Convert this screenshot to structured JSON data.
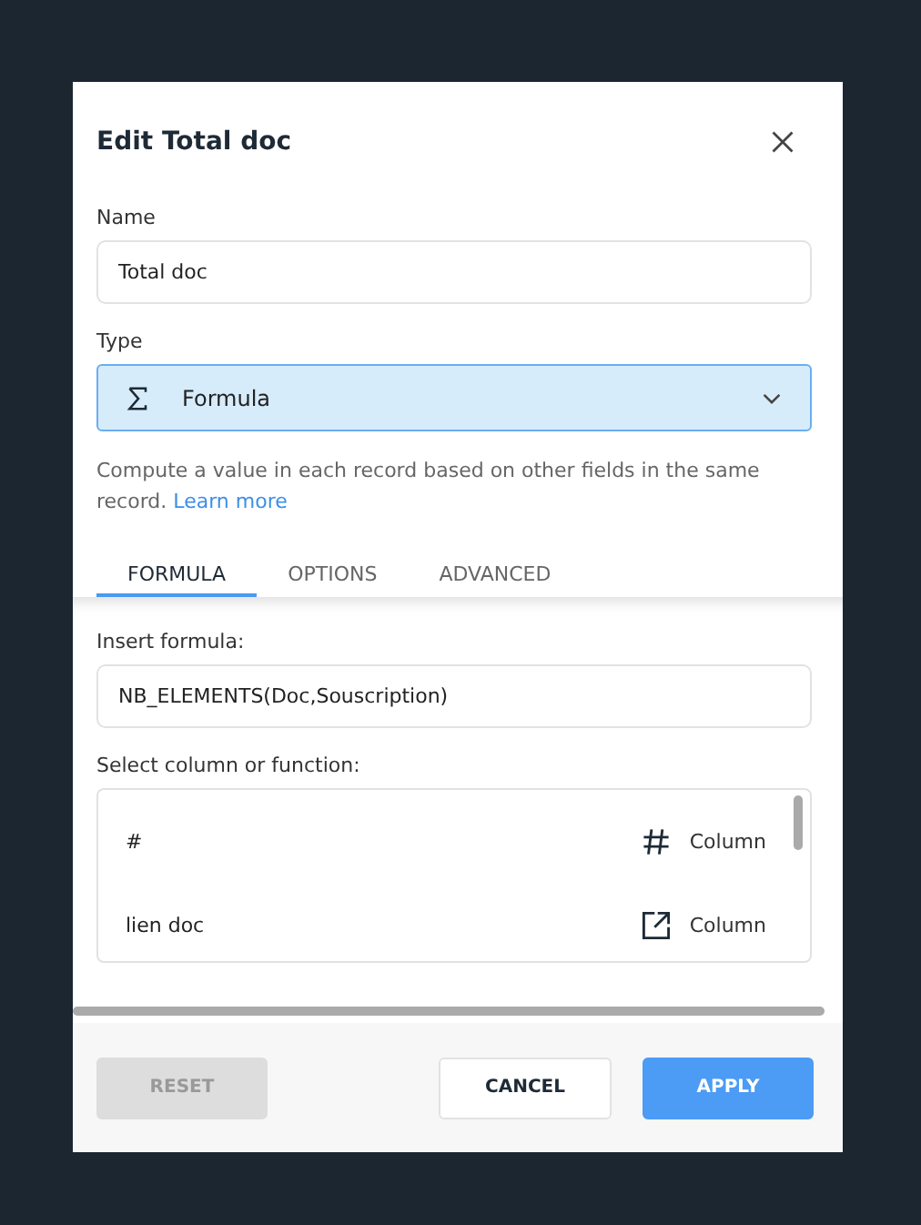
{
  "dialog": {
    "title": "Edit Total doc"
  },
  "name_field": {
    "label": "Name",
    "value": "Total doc"
  },
  "type_field": {
    "label": "Type",
    "value": "Formula",
    "focused": true
  },
  "description": {
    "text": "Compute a value in each record based on other fields in the same record. ",
    "link": "Learn more"
  },
  "tabs": [
    {
      "label": "FORMULA",
      "selected": true
    },
    {
      "label": "OPTIONS",
      "selected": false
    },
    {
      "label": "ADVANCED",
      "selected": false
    }
  ],
  "formula": {
    "label": "Insert formula:",
    "value": "NB_ELEMENTS(Doc,Souscription)"
  },
  "picker": {
    "label": "Select column or function:",
    "items": [
      {
        "name": "#",
        "kind": "number",
        "type": "Column"
      },
      {
        "name": "lien doc",
        "kind": "link",
        "type": "Column"
      }
    ]
  },
  "buttons": [
    {
      "label": "RESET",
      "kind": "secondary",
      "disabled": true
    },
    {
      "label": "CANCEL",
      "kind": "secondary",
      "disabled": false
    },
    {
      "label": "APPLY",
      "kind": "primary",
      "disabled": false
    }
  ]
}
